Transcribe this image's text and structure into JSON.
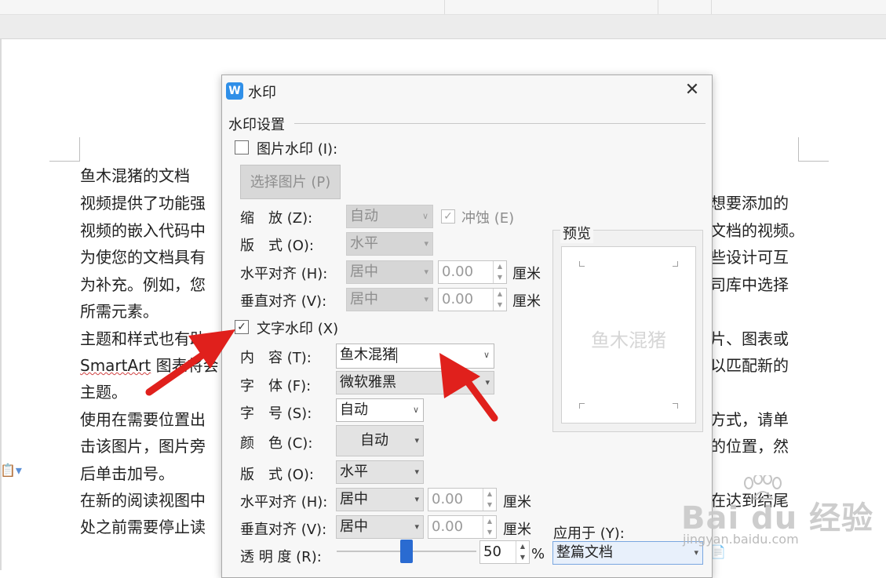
{
  "document": {
    "left_lines": [
      "鱼木混猪的文档",
      "视频提供了功能强",
      "视频的嵌入代码中",
      "为使您的文档具有",
      "为补充。例如，您",
      "所需元素。",
      "主题和样式也有助",
      "图表将会",
      "主题。",
      "使用在需要位置出",
      "击该图片，图片旁",
      "后单击加号。",
      "在新的阅读视图中",
      "处之前需要停止读"
    ],
    "smartart_word": "SmartArt",
    "right_lines": [
      "想要添加的",
      "文档的视频。",
      "些设计可互",
      "司库中选择",
      "片、图表或",
      "以匹配新的",
      "方式，请单",
      "的位置，然",
      "在达到结尾"
    ]
  },
  "dialog": {
    "title": "水印",
    "logo_glyph": "W",
    "close_glyph": "✕",
    "group_title": "水印设置",
    "picture": {
      "checkbox_label": "图片水印 (I):",
      "select_button": "选择图片 (P)",
      "scale_label": "缩　放 (Z):",
      "scale_value": "自动",
      "washout_label": "冲蚀 (E)",
      "layout_label": "版　式 (O):",
      "layout_value": "水平",
      "halign_label": "水平对齐 (H):",
      "halign_value": "居中",
      "halign_num": "0.00",
      "halign_unit": "厘米",
      "valign_label": "垂直对齐 (V):",
      "valign_value": "居中",
      "valign_num": "0.00",
      "valign_unit": "厘米"
    },
    "text": {
      "checkbox_label": "文字水印 (X)",
      "content_label": "内　容 (T):",
      "content_value": "鱼木混猪",
      "font_label": "字　体 (F):",
      "font_value": "微软雅黑",
      "size_label": "字　号 (S):",
      "size_value": "自动",
      "color_label": "颜　色 (C):",
      "color_value": "自动",
      "layout_label": "版　式 (O):",
      "layout_value": "水平",
      "halign_label": "水平对齐 (H):",
      "halign_value": "居中",
      "halign_num": "0.00",
      "halign_unit": "厘米",
      "valign_label": "垂直对齐 (V):",
      "valign_value": "居中",
      "valign_num": "0.00",
      "valign_unit": "厘米",
      "transparency_label": "透 明 度 (R):",
      "transparency_value": "50",
      "transparency_unit": "%",
      "transparency_fraction": 0.5
    },
    "preview": {
      "label": "预览",
      "watermark_text": "鱼木混猪"
    },
    "apply": {
      "label": "应用于 (Y):",
      "value": "整篇文档"
    }
  },
  "watermark": {
    "main": "Bai du 经验",
    "sub": "jingyan.baidu.com"
  },
  "colors": {
    "annotation_arrow": "#e0201c",
    "accent": "#2a6bd1"
  }
}
